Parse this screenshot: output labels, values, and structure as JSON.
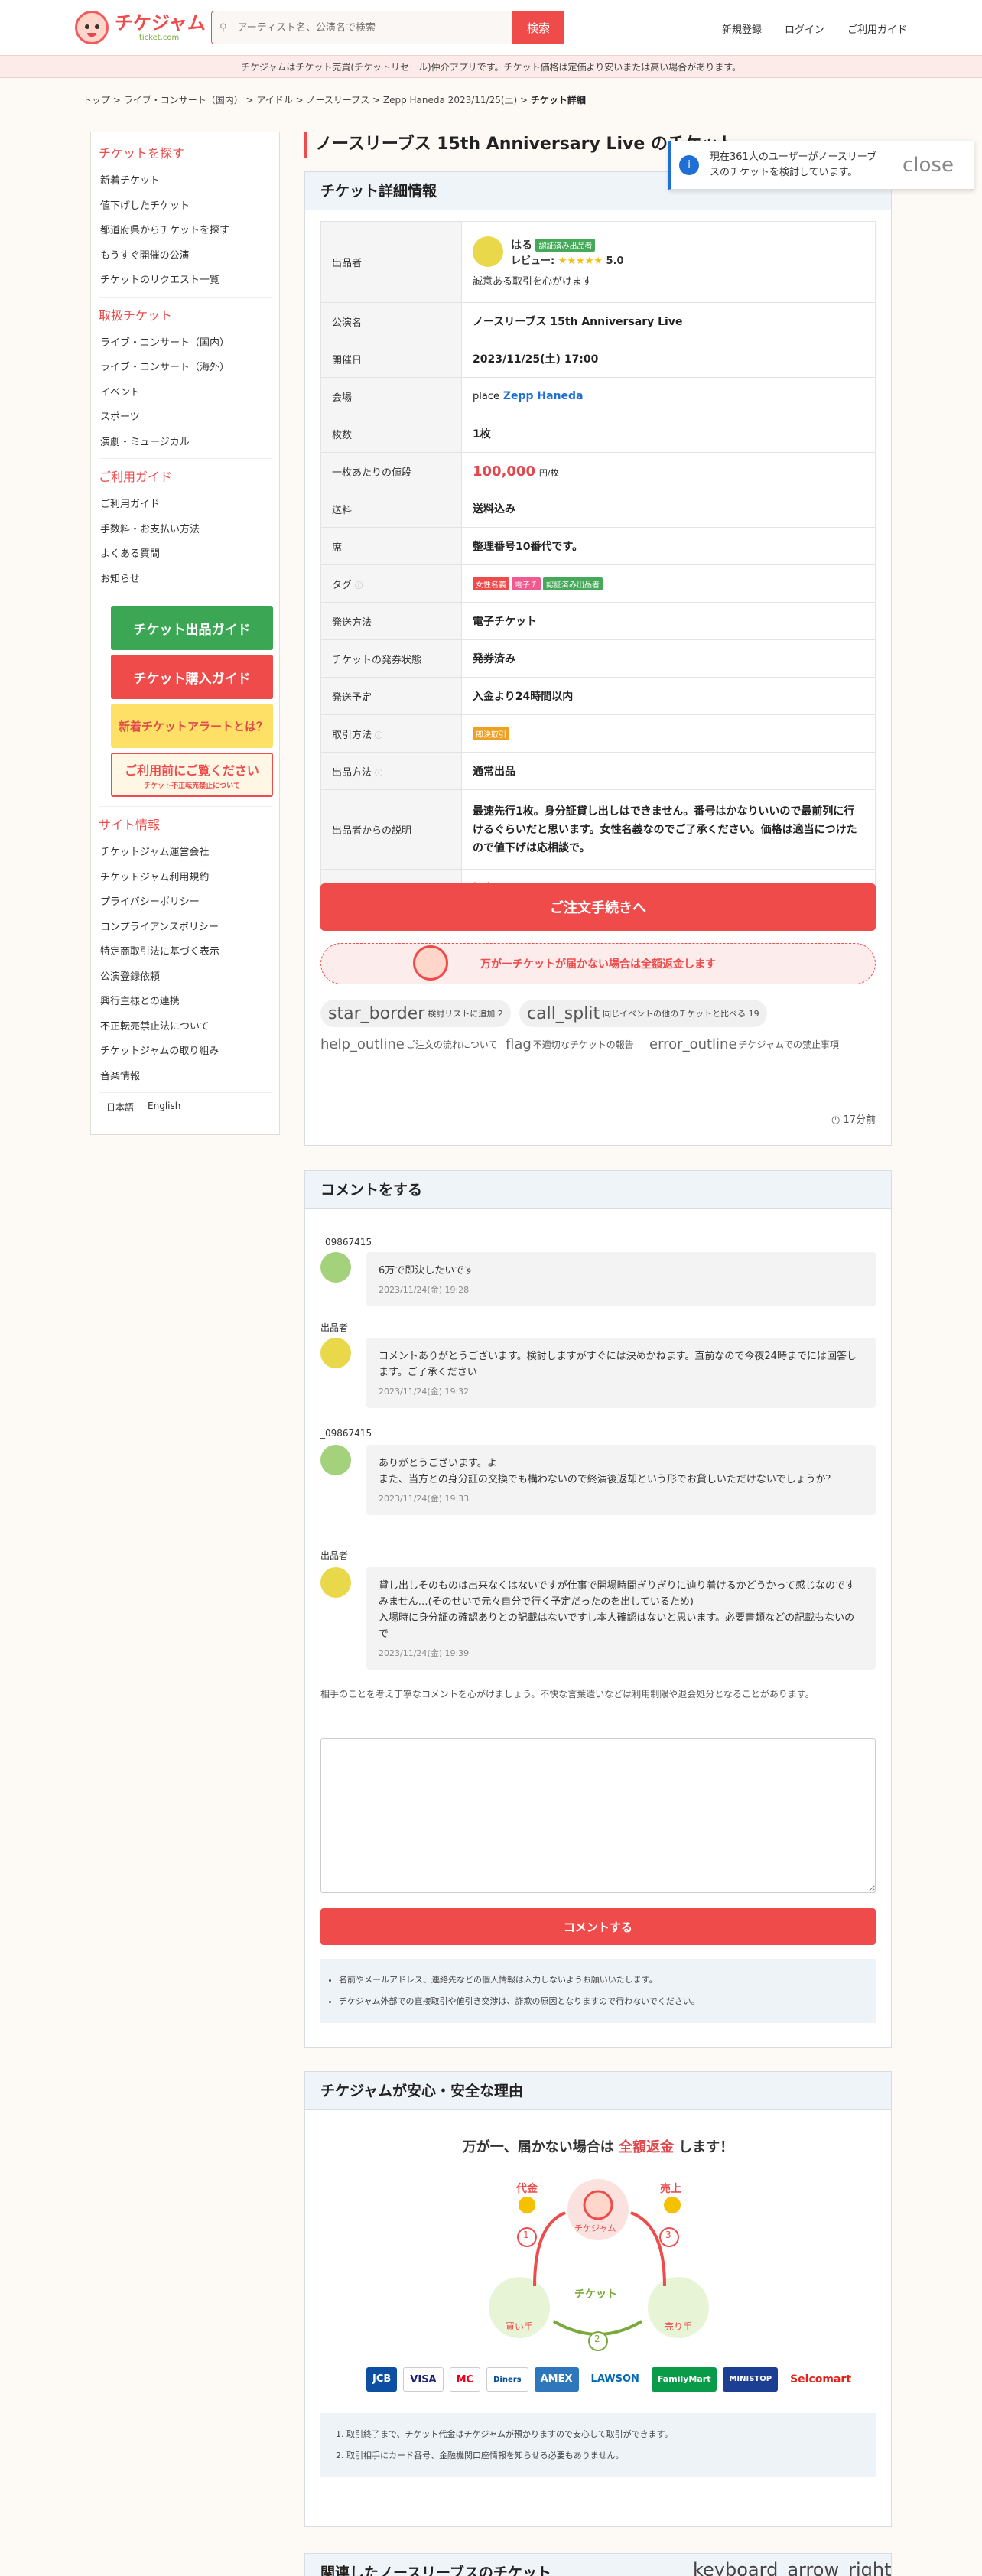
{
  "header": {
    "logo_main": "チケジャム",
    "logo_sub": "ticket.com",
    "search_placeholder": "アーティスト名、公演名で検索",
    "search_icon": "search-icon",
    "search_button": "検索",
    "nav": [
      "新規登録",
      "ログイン",
      "ご利用ガイド"
    ]
  },
  "notice": "チケジャムはチケット売買(チケットリセール)仲介アプリです。チケット価格は定価より安いまたは高い場合があります。",
  "breadcrumb": [
    "トップ",
    "ライブ・コンサート（国内）",
    "アイドル",
    "ノースリーブス",
    "Zepp Haneda 2023/11/25(土)",
    "チケット詳細"
  ],
  "sidebar": {
    "find_title": "チケットを探す",
    "find_items": [
      "新着チケット",
      "値下げしたチケット",
      "都道府県からチケットを探す",
      "もうすぐ開催の公演",
      "チケットのリクエスト一覧"
    ],
    "genre_title": "取扱チケット",
    "genre_items": [
      "ライブ・コンサート（国内）",
      "ライブ・コンサート（海外）",
      "イベント",
      "スポーツ",
      "演劇・ミュージカル"
    ],
    "guide_title": "ご利用ガイド",
    "guide_items": [
      "ご利用ガイド",
      "手数料・お支払い方法",
      "よくある質問",
      "お知らせ"
    ],
    "banners": [
      "チケット出品ガイド",
      "チケット購入ガイド",
      "新着チケットアラートとは？",
      "ご利用前にご覧ください",
      "チケット不正転売禁止について"
    ],
    "site_title": "サイト情報",
    "site_items": [
      "チケットジャム運営会社",
      "チケットジャム利用規約",
      "プライバシーポリシー",
      "コンプライアンスポリシー",
      "特定商取引法に基づく表示",
      "公演登録依頼",
      "興行主様との連携",
      "不正転売禁止法について",
      "チケットジャムの取り組み",
      "音楽情報"
    ],
    "langs": [
      "日本語",
      "English"
    ]
  },
  "title": "ノースリーブス 15th Anniversary Live のチケット",
  "toast": {
    "icon": "info-icon",
    "text": "現在361人のユーザーがノースリーブスのチケットを検討しています。",
    "close": "close"
  },
  "detail": {
    "heading": "チケット詳細情報",
    "seller_label": "出品者",
    "seller_name": "はる",
    "seller_badge": "認証済み出品者",
    "review_label": "レビュー:",
    "review_score": "5.0",
    "seller_note": "誠意ある取引を心がけます",
    "rows": [
      {
        "k": "公演名",
        "v": "ノースリーブス 15th Anniversary Live"
      },
      {
        "k": "開催日",
        "v": "2023/11/25(土) 17:00"
      },
      {
        "k": "会場",
        "v": "Zepp Haneda"
      },
      {
        "k": "枚数",
        "v": "1枚"
      },
      {
        "k": "一枚あたりの値段",
        "v": "100,000",
        "unit": "円/枚"
      },
      {
        "k": "送料",
        "v": "送料込み"
      },
      {
        "k": "席",
        "v": "整理番号10番代です。"
      },
      {
        "k": "タグ",
        "v": ""
      },
      {
        "k": "発送方法",
        "v": "電子チケット"
      },
      {
        "k": "チケットの発券状態",
        "v": "発券済み"
      },
      {
        "k": "発送予定",
        "v": "入金より24時間以内"
      },
      {
        "k": "取引方法",
        "v": ""
      },
      {
        "k": "出品方法",
        "v": "通常出品"
      },
      {
        "k": "出品者からの説明",
        "v": "最速先行1枚。身分証貸し出しはできません。番号はかなりいいので最前列に行けるぐらいだと思います。女性名義なのでご了承ください。価格は適当につけたので値下げは応相談で。"
      },
      {
        "k": "出品終了日",
        "v": "設定なし"
      }
    ],
    "venue_prefix": "place",
    "tags": [
      "女性名義",
      "電子チ",
      "認証済み出品者"
    ],
    "trade_tag": "即決取引",
    "order_button": "ご注文手続きへ",
    "refund": "万が一チケットが届かない場合は全額返金します",
    "chips": [
      {
        "icon": "star_border",
        "label": "検討リストに追加 2"
      },
      {
        "icon": "call_split",
        "label": "同じイベントの他のチケットと比べる 19"
      }
    ],
    "links": [
      {
        "icon": "help_outline",
        "label": "ご注文の流れについて"
      },
      {
        "icon": "flag",
        "label": "不適切なチケットの報告"
      },
      {
        "icon": "error_outline",
        "label": "チケジャムでの禁止事項"
      }
    ],
    "posted": "17分前"
  },
  "comments": {
    "heading": "コメントをする",
    "items": [
      {
        "user": "_09867415",
        "text": "6万で即決したいです",
        "date": "2023/11/24(金) 19:28"
      },
      {
        "user": "出品者",
        "text": "コメントありがとうございます。検討しますがすぐには決めかねます。直前なので今夜24時までには回答します。ご了承ください",
        "date": "2023/11/24(金) 19:32"
      },
      {
        "user": "_09867415",
        "text": "ありがとうございます。よ\nまた、当方との身分証の交換でも構わないので終演後返却という形でお貸しいただけないでしょうか？",
        "date": "2023/11/24(金) 19:33"
      },
      {
        "user": "出品者",
        "text": "貸し出しそのものは出来なくはないですが仕事で開場時間ぎりぎりに辿り着けるかどうかって感じなのですみません…(そのせいで元々自分で行く予定だったのを出しているため)\n入場時に身分証の確認ありとの記載はないですし本人確認はないと思います。必要書類などの記載もないので",
        "date": "2023/11/24(金) 19:39"
      }
    ],
    "guide": "相手のことを考え丁寧なコメントを心がけましょう。不快な言葉遣いなどは利用制限や退会処分となることがあります。",
    "submit": "コメントする",
    "notes": [
      "名前やメールアドレス、連絡先などの個人情報は入力しないようお願いいたします。",
      "チケジャム外部での直接取引や値引き交渉は、詐欺の原因となりますので行わないでください。"
    ]
  },
  "safety": {
    "heading": "チケジャムが安心・安全な理由",
    "lead_a": "万が一、届かない場合は",
    "lead_b": "全額返金",
    "lead_c": "します！",
    "labels": {
      "price": "代金",
      "sales": "売上",
      "ticket": "チケット",
      "buyer": "買い手",
      "seller": "売り手",
      "center": "チケジャム"
    },
    "payments": [
      "JCB",
      "VISA",
      "MC",
      "Diners",
      "AMEX",
      "LAWSON",
      "FamilyMart",
      "MINISTOP",
      "Seicomart"
    ],
    "notes": [
      "取引終了まで、チケット代金はチケジャムが預かりますので安心して取引ができます。",
      "取引相手にカード番号、金融機関口座情報を知らせる必要もありません。"
    ]
  },
  "related_heading": "関連したノースリーブスのチケット",
  "keyboard": "keyboard_arrow_right",
  "colors": {
    "accent": "#ef4b4b",
    "link": "#1f6fd6",
    "green": "#46a95a"
  }
}
